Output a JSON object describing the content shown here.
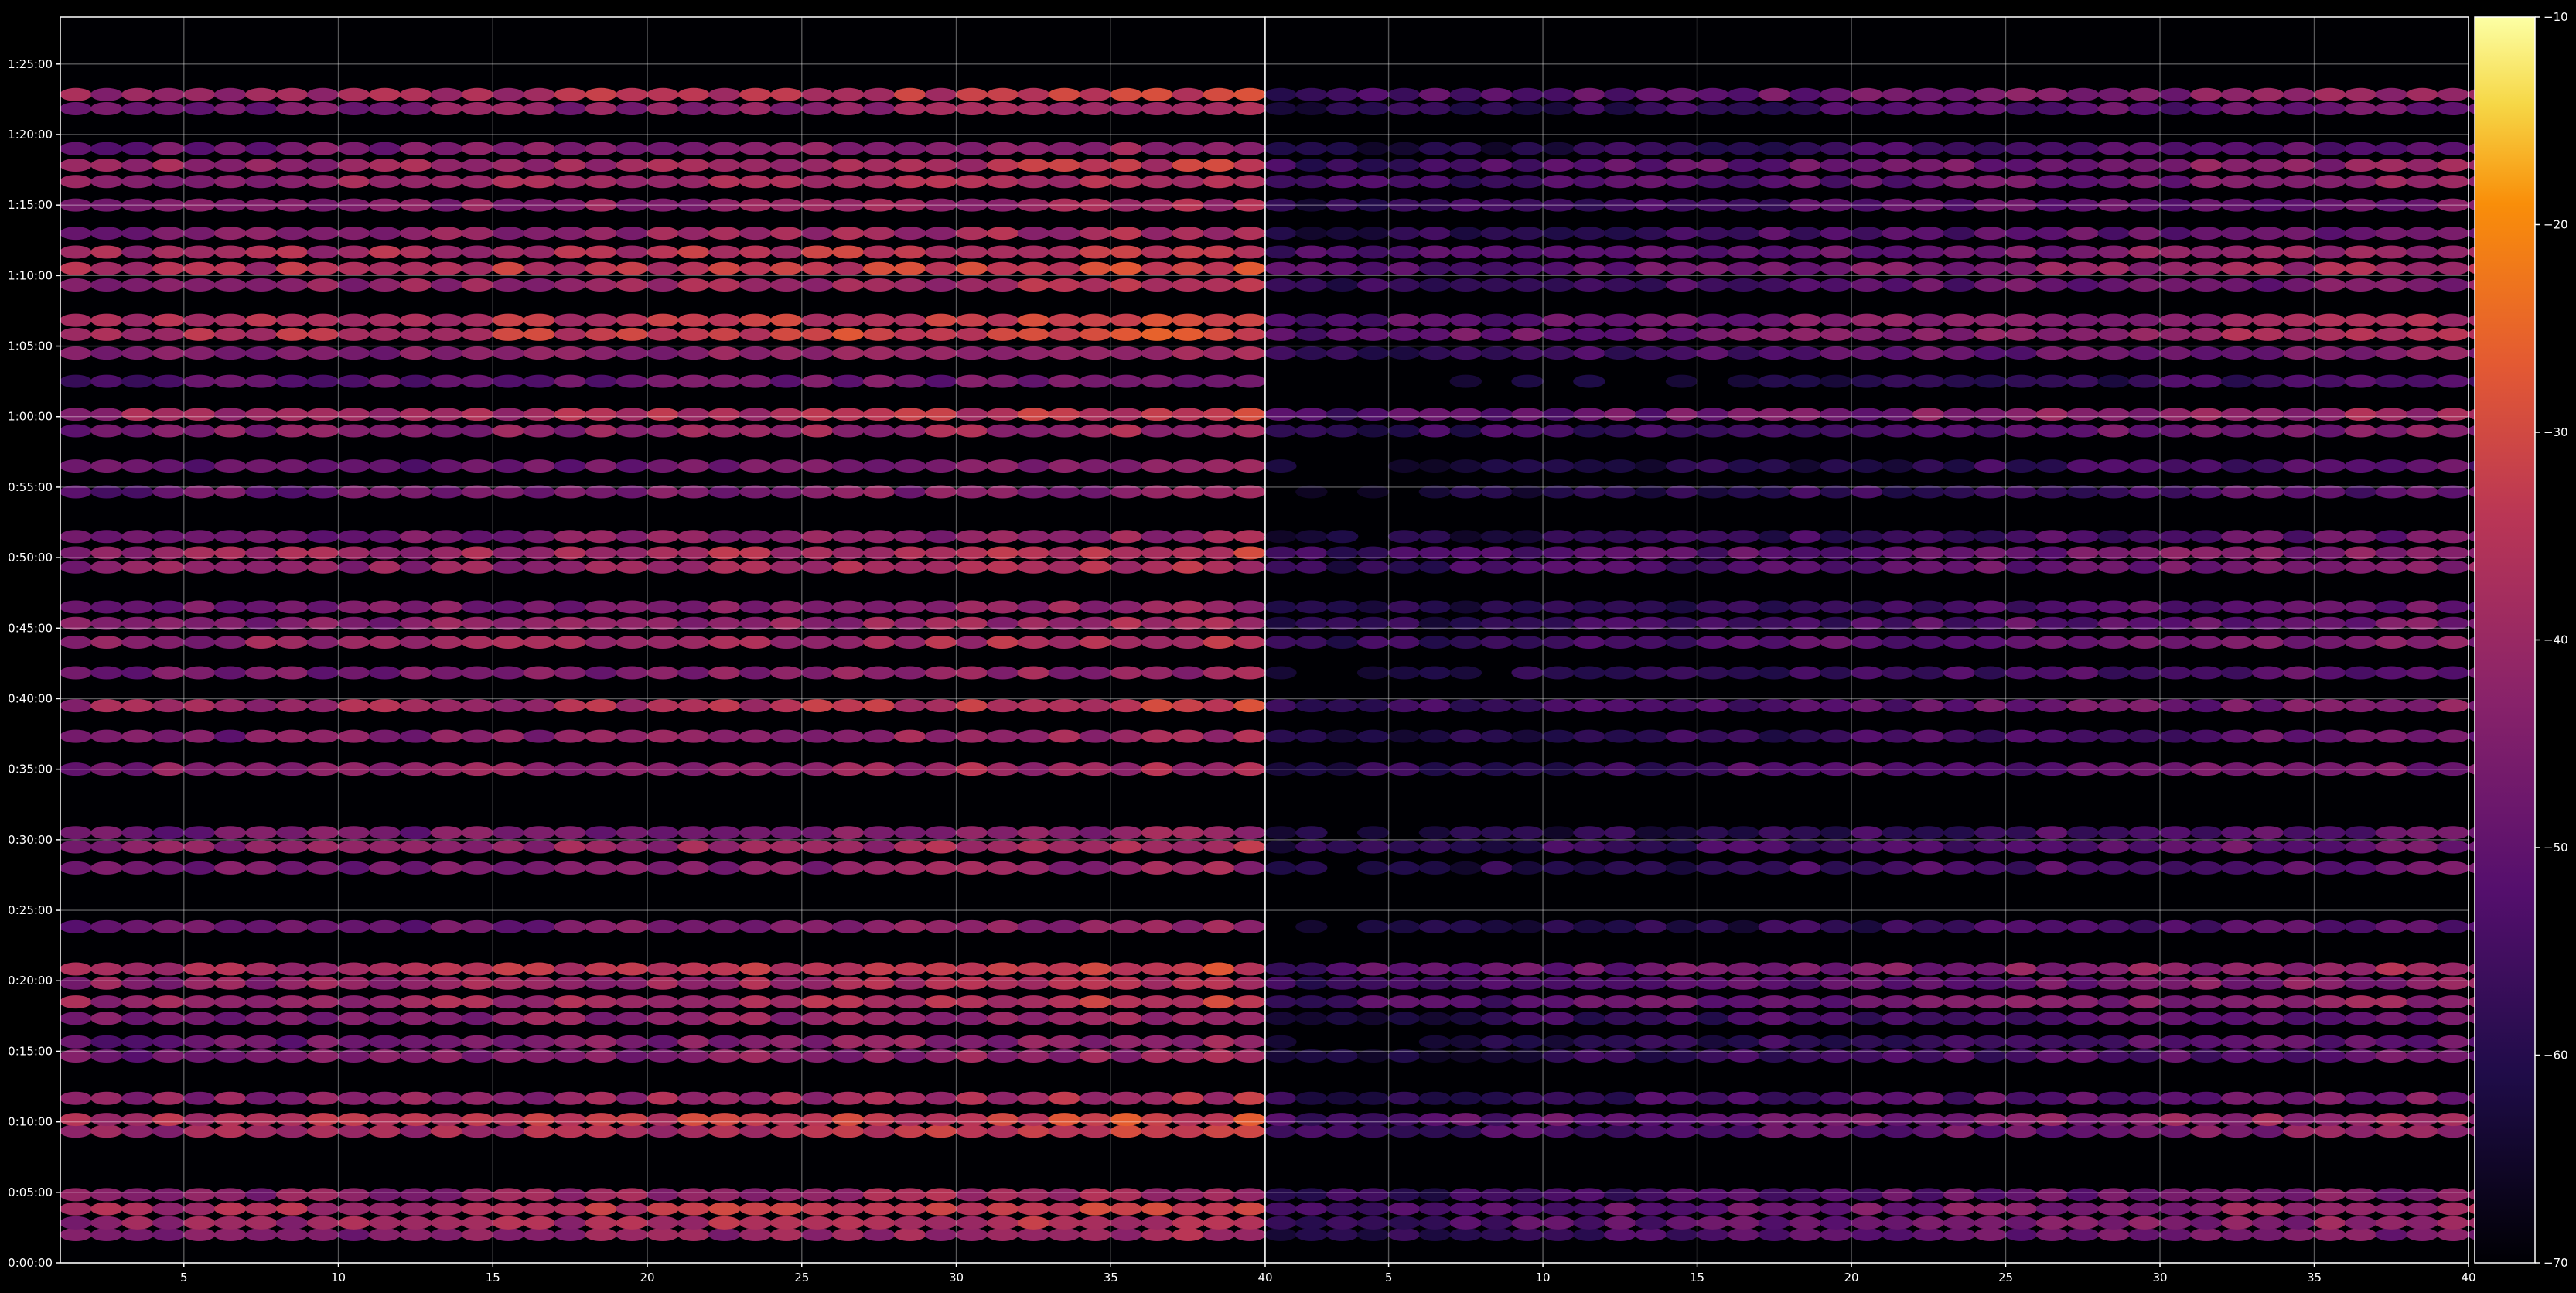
{
  "chart_data": {
    "type": "heatmap",
    "title": "",
    "cmap": "inferno",
    "vmin": -70,
    "vmax": -10,
    "grid": true,
    "legend": "colorbar-right",
    "colorbar": {
      "range": [
        -70,
        -10
      ],
      "ticks": [
        -70,
        -60,
        -50,
        -40,
        -30,
        -20,
        -10
      ],
      "labels": [
        "−70",
        "−60",
        "−50",
        "−40",
        "−30",
        "−20",
        "−10"
      ]
    },
    "y_axis": {
      "label": "",
      "range_seconds": [
        0,
        5300
      ],
      "ticks_seconds": [
        0,
        300,
        600,
        900,
        1200,
        1500,
        1800,
        2100,
        2400,
        2700,
        3000,
        3300,
        3600,
        3900,
        4200,
        4500,
        4800,
        5100
      ],
      "tick_labels": [
        "0:00:00",
        "0:05:00",
        "0:10:00",
        "0:15:00",
        "0:20:00",
        "0:25:00",
        "0:30:00",
        "0:35:00",
        "0:40:00",
        "0:45:00",
        "0:50:00",
        "0:55:00",
        "1:00:00",
        "1:05:00",
        "1:10:00",
        "1:15:00",
        "1:20:00",
        "1:25:00"
      ]
    },
    "panels": [
      {
        "name": "left",
        "x_range": [
          1,
          40
        ],
        "x_ticks": [
          5,
          10,
          15,
          20,
          25,
          30,
          35,
          40
        ],
        "x_tick_labels": [
          "5",
          "10",
          "15",
          "20",
          "25",
          "30",
          "35",
          "40"
        ],
        "x_label": "",
        "bands": [
          {
            "t": 120,
            "v": -38
          },
          {
            "t": 170,
            "v": -34
          },
          {
            "t": 230,
            "v": -31
          },
          {
            "t": 290,
            "v": -37
          },
          {
            "t": 560,
            "v": -33
          },
          {
            "t": 610,
            "v": -30
          },
          {
            "t": 700,
            "v": -36
          },
          {
            "t": 880,
            "v": -40
          },
          {
            "t": 940,
            "v": -41
          },
          {
            "t": 1040,
            "v": -38
          },
          {
            "t": 1110,
            "v": -33
          },
          {
            "t": 1190,
            "v": -35
          },
          {
            "t": 1250,
            "v": -31
          },
          {
            "t": 1430,
            "v": -42
          },
          {
            "t": 1680,
            "v": -40
          },
          {
            "t": 1770,
            "v": -37
          },
          {
            "t": 1830,
            "v": -41
          },
          {
            "t": 2100,
            "v": -37
          },
          {
            "t": 2240,
            "v": -39
          },
          {
            "t": 2370,
            "v": -33
          },
          {
            "t": 2510,
            "v": -40
          },
          {
            "t": 2640,
            "v": -35
          },
          {
            "t": 2720,
            "v": -38
          },
          {
            "t": 2790,
            "v": -40
          },
          {
            "t": 2960,
            "v": -36
          },
          {
            "t": 3020,
            "v": -34
          },
          {
            "t": 3090,
            "v": -40
          },
          {
            "t": 3280,
            "v": -42
          },
          {
            "t": 3390,
            "v": -43
          },
          {
            "t": 3540,
            "v": -38
          },
          {
            "t": 3610,
            "v": -33
          },
          {
            "t": 3750,
            "v": -45
          },
          {
            "t": 3870,
            "v": -38
          },
          {
            "t": 3950,
            "v": -29
          },
          {
            "t": 4010,
            "v": -31
          },
          {
            "t": 4160,
            "v": -36
          },
          {
            "t": 4230,
            "v": -30
          },
          {
            "t": 4300,
            "v": -32
          },
          {
            "t": 4380,
            "v": -37
          },
          {
            "t": 4500,
            "v": -38
          },
          {
            "t": 4600,
            "v": -35
          },
          {
            "t": 4670,
            "v": -34
          },
          {
            "t": 4740,
            "v": -40
          },
          {
            "t": 4910,
            "v": -39
          },
          {
            "t": 4970,
            "v": -32
          }
        ]
      },
      {
        "name": "right",
        "x_range": [
          1,
          40
        ],
        "x_ticks": [
          5,
          10,
          15,
          20,
          25,
          30,
          35,
          40
        ],
        "x_tick_labels": [
          "5",
          "10",
          "15",
          "20",
          "25",
          "30",
          "35",
          "40"
        ],
        "x_label": "",
        "bands": [
          {
            "t": 120,
            "v": -44
          },
          {
            "t": 170,
            "v": -41
          },
          {
            "t": 230,
            "v": -39
          },
          {
            "t": 290,
            "v": -44
          },
          {
            "t": 560,
            "v": -42
          },
          {
            "t": 610,
            "v": -39
          },
          {
            "t": 700,
            "v": -45
          },
          {
            "t": 880,
            "v": -48
          },
          {
            "t": 940,
            "v": -49
          },
          {
            "t": 1040,
            "v": -46
          },
          {
            "t": 1110,
            "v": -40
          },
          {
            "t": 1190,
            "v": -42
          },
          {
            "t": 1250,
            "v": -38
          },
          {
            "t": 1430,
            "v": -50
          },
          {
            "t": 1680,
            "v": -48
          },
          {
            "t": 1770,
            "v": -46
          },
          {
            "t": 1830,
            "v": -49
          },
          {
            "t": 2100,
            "v": -45
          },
          {
            "t": 2240,
            "v": -48
          },
          {
            "t": 2370,
            "v": -44
          },
          {
            "t": 2510,
            "v": -49
          },
          {
            "t": 2640,
            "v": -44
          },
          {
            "t": 2720,
            "v": -46
          },
          {
            "t": 2790,
            "v": -48
          },
          {
            "t": 2960,
            "v": -44
          },
          {
            "t": 3020,
            "v": -42
          },
          {
            "t": 3090,
            "v": -48
          },
          {
            "t": 3280,
            "v": -50
          },
          {
            "t": 3390,
            "v": -51
          },
          {
            "t": 3540,
            "v": -44
          },
          {
            "t": 3610,
            "v": -38
          },
          {
            "t": 3750,
            "v": -53
          },
          {
            "t": 3870,
            "v": -44
          },
          {
            "t": 3950,
            "v": -36
          },
          {
            "t": 4010,
            "v": -38
          },
          {
            "t": 4160,
            "v": -44
          },
          {
            "t": 4230,
            "v": -38
          },
          {
            "t": 4300,
            "v": -40
          },
          {
            "t": 4380,
            "v": -45
          },
          {
            "t": 4500,
            "v": -45
          },
          {
            "t": 4600,
            "v": -42
          },
          {
            "t": 4670,
            "v": -41
          },
          {
            "t": 4740,
            "v": -48
          },
          {
            "t": 4910,
            "v": -47
          },
          {
            "t": 4970,
            "v": -40
          }
        ]
      }
    ]
  }
}
